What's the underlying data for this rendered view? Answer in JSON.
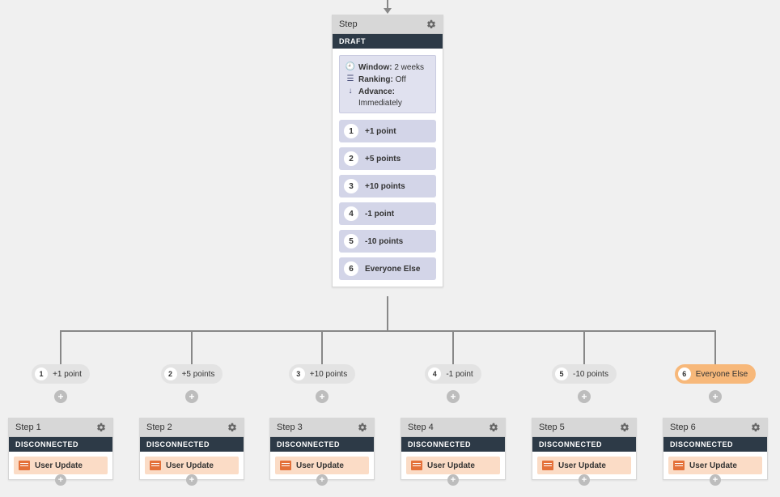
{
  "mainStep": {
    "title": "Step",
    "status": "DRAFT",
    "meta": {
      "windowLabel": "Window:",
      "windowValue": "2 weeks",
      "rankingLabel": "Ranking:",
      "rankingValue": "Off",
      "advanceLabel": "Advance:",
      "advanceValue": "Immediately"
    },
    "options": [
      {
        "n": "1",
        "label": "+1 point"
      },
      {
        "n": "2",
        "label": "+5 points"
      },
      {
        "n": "3",
        "label": "+10 points"
      },
      {
        "n": "4",
        "label": "-1 point"
      },
      {
        "n": "5",
        "label": "-10 points"
      },
      {
        "n": "6",
        "label": "Everyone Else"
      }
    ]
  },
  "branches": [
    {
      "n": "1",
      "label": "+1 point",
      "orange": false
    },
    {
      "n": "2",
      "label": "+5 points",
      "orange": false
    },
    {
      "n": "3",
      "label": "+10 points",
      "orange": false
    },
    {
      "n": "4",
      "label": "-1 point",
      "orange": false
    },
    {
      "n": "5",
      "label": "-10 points",
      "orange": false
    },
    {
      "n": "6",
      "label": "Everyone Else",
      "orange": true
    }
  ],
  "childSteps": [
    {
      "title": "Step 1",
      "status": "DISCONNECTED",
      "action": "User Update"
    },
    {
      "title": "Step 2",
      "status": "DISCONNECTED",
      "action": "User Update"
    },
    {
      "title": "Step 3",
      "status": "DISCONNECTED",
      "action": "User Update"
    },
    {
      "title": "Step 4",
      "status": "DISCONNECTED",
      "action": "User Update"
    },
    {
      "title": "Step 5",
      "status": "DISCONNECTED",
      "action": "User Update"
    },
    {
      "title": "Step 6",
      "status": "DISCONNECTED",
      "action": "User Update"
    }
  ]
}
